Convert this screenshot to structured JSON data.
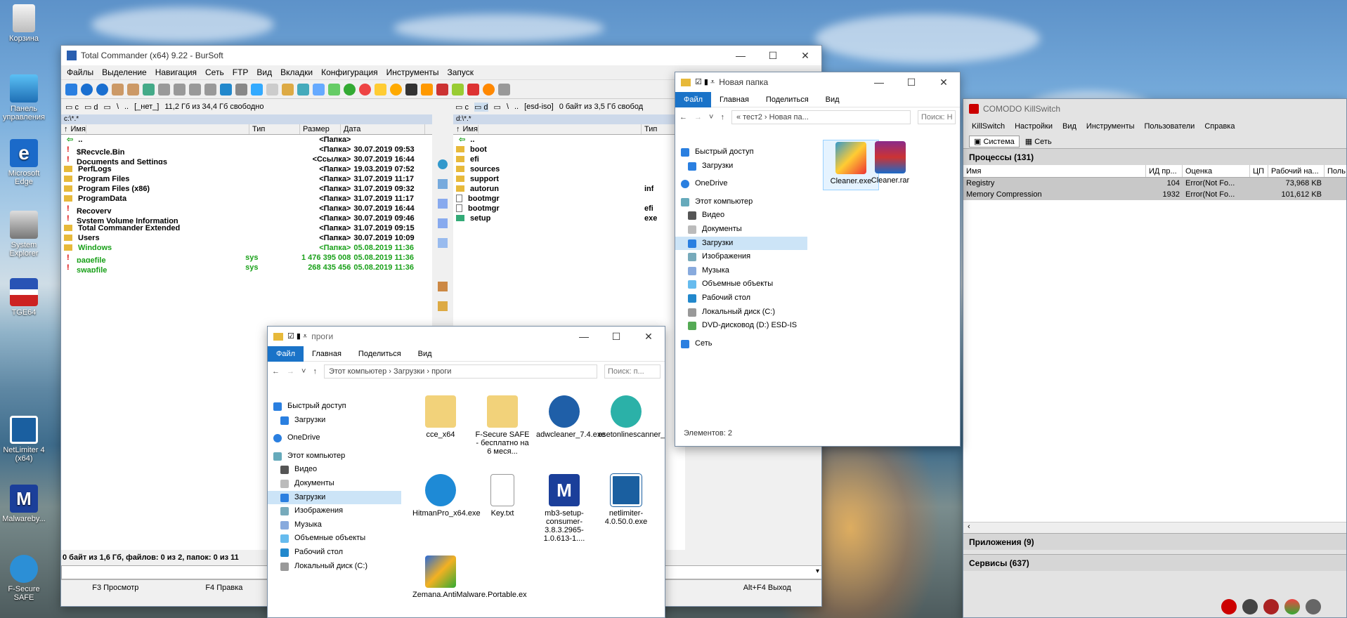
{
  "desktop": {
    "icons": [
      "Корзина",
      "Панель управления",
      "Microsoft Edge",
      "System Explorer",
      "TGE64",
      "NetLimiter 4 (x64)",
      "Malwareby...",
      "F-Secure SAFE"
    ]
  },
  "tc": {
    "title": "Total Commander (x64) 9.22 - BurSoft",
    "menu": [
      "Файлы",
      "Выделение",
      "Навигация",
      "Сеть",
      "FTP",
      "Вид",
      "Вкладки",
      "Конфигурация",
      "Инструменты",
      "Запуск"
    ],
    "left_drive": "c",
    "left_drive2": "d",
    "left_net": "[_нет_]",
    "left_free": "11,2 Гб из 34,4 Гб свободно",
    "right_drive": "c",
    "right_drive2": "d",
    "right_net": "[esd-iso]",
    "right_free": "0 байт из 3,5 Гб свобод",
    "left_path": "c:\\*.*",
    "right_path": "d:\\*.*",
    "col_name": "Имя",
    "col_type": "Тип",
    "col_size": "Размер",
    "col_date": "Дата",
    "left_rows": [
      {
        "name": "..",
        "type": "",
        "size": "<Папка>",
        "date": ""
      },
      {
        "name": "$Recycle.Bin",
        "type": "",
        "size": "<Папка>",
        "date": "30.07.2019 09:53"
      },
      {
        "name": "Documents and Settings",
        "type": "",
        "size": "<Ссылка>",
        "date": "30.07.2019 16:44"
      },
      {
        "name": "PerfLogs",
        "type": "",
        "size": "<Папка>",
        "date": "19.03.2019 07:52"
      },
      {
        "name": "Program Files",
        "type": "",
        "size": "<Папка>",
        "date": "31.07.2019 11:17"
      },
      {
        "name": "Program Files (x86)",
        "type": "",
        "size": "<Папка>",
        "date": "31.07.2019 09:32"
      },
      {
        "name": "ProgramData",
        "type": "",
        "size": "<Папка>",
        "date": "31.07.2019 11:17"
      },
      {
        "name": "Recovery",
        "type": "",
        "size": "<Папка>",
        "date": "30.07.2019 16:44"
      },
      {
        "name": "System Volume Information",
        "type": "",
        "size": "<Папка>",
        "date": "30.07.2019 09:46"
      },
      {
        "name": "Total Commander Extended",
        "type": "",
        "size": "<Папка>",
        "date": "31.07.2019 09:15"
      },
      {
        "name": "Users",
        "type": "",
        "size": "<Папка>",
        "date": "30.07.2019 10:09"
      },
      {
        "name": "Windows",
        "type": "",
        "size": "<Папка>",
        "date": "05.08.2019 11:36"
      },
      {
        "name": "pagefile",
        "type": "sys",
        "size": "1 476 395 008",
        "date": "05.08.2019 11:36"
      },
      {
        "name": "swapfile",
        "type": "sys",
        "size": "268 435 456",
        "date": "05.08.2019 11:36"
      }
    ],
    "right_rows": [
      {
        "name": "..",
        "type": ""
      },
      {
        "name": "boot",
        "type": ""
      },
      {
        "name": "efi",
        "type": ""
      },
      {
        "name": "sources",
        "type": ""
      },
      {
        "name": "support",
        "type": ""
      },
      {
        "name": "autorun",
        "type": "inf"
      },
      {
        "name": "bootmgr",
        "type": ""
      },
      {
        "name": "bootmgr",
        "type": "efi"
      },
      {
        "name": "setup",
        "type": "exe"
      }
    ],
    "status": "0 байт из 1,6 Гб, файлов: 0 из 2, папок: 0 из 11",
    "fkeys": [
      "F3 Просмотр",
      "F4 Правка",
      "",
      "",
      "",
      "",
      "",
      "Alt+F4 Выход"
    ],
    "fkey_partial": "ие"
  },
  "ex1": {
    "title": "Новая папка",
    "ribbon": [
      "Файл",
      "Главная",
      "Поделиться",
      "Вид"
    ],
    "path": [
      "«",
      "тест2",
      "›",
      "Новая па..."
    ],
    "search": "Поиск: Н",
    "nav": [
      "Быстрый доступ",
      "Загрузки",
      "OneDrive",
      "Этот компьютер",
      "Видео",
      "Документы",
      "Загрузки",
      "Изображения",
      "Музыка",
      "Объемные объекты",
      "Рабочий стол",
      "Локальный диск (C:)",
      "DVD-дисковод (D:) ESD-IS",
      "Сеть"
    ],
    "files": [
      "Cleaner.exe",
      "Cleaner.rar"
    ],
    "status": "Элементов: 2"
  },
  "ex2": {
    "title": "проги",
    "ribbon": [
      "Файл",
      "Главная",
      "Поделиться",
      "Вид"
    ],
    "path": [
      "Этот компьютер",
      "›",
      "Загрузки",
      "›",
      "проги"
    ],
    "search": "Поиск: п...",
    "nav": [
      "Быстрый доступ",
      "Загрузки",
      "OneDrive",
      "Этот компьютер",
      "Видео",
      "Документы",
      "Загрузки",
      "Изображения",
      "Музыка",
      "Объемные объекты",
      "Рабочий стол",
      "Локальный диск (C:)"
    ],
    "files": [
      "cce_x64",
      "F-Secure SAFE - бесплатно на 6 меся...",
      "adwcleaner_7.4.exe",
      "esetonlinescanner_rus.exe",
      "HitmanPro_x64.exe",
      "Key.txt",
      "mb3-setup-consumer-3.8.3.2965-1.0.613-1....",
      "netlimiter-4.0.50.0.exe",
      "Zemana.AntiMalware.Portable.ex"
    ]
  },
  "comodo": {
    "title": "COMODO KillSwitch",
    "menu": [
      "KillSwitch",
      "Настройки",
      "Вид",
      "Инструменты",
      "Пользователи",
      "Справка"
    ],
    "tabs": [
      "Система",
      "Сеть"
    ],
    "processes": "Процессы (131)",
    "cols": [
      "Имя",
      "ИД пр...",
      "Оценка",
      "ЦП",
      "Рабочий на...",
      "Поль"
    ],
    "rows": [
      {
        "name": "Registry",
        "pid": "104",
        "rating": "Error(Not Fo...",
        "cpu": "",
        "mem": "73,968 KB"
      },
      {
        "name": "Memory Compression",
        "pid": "1932",
        "rating": "Error(Not Fo...",
        "cpu": "",
        "mem": "101,612 KB"
      }
    ],
    "apps": "Приложения (9)",
    "services": "Сервисы (637)"
  }
}
